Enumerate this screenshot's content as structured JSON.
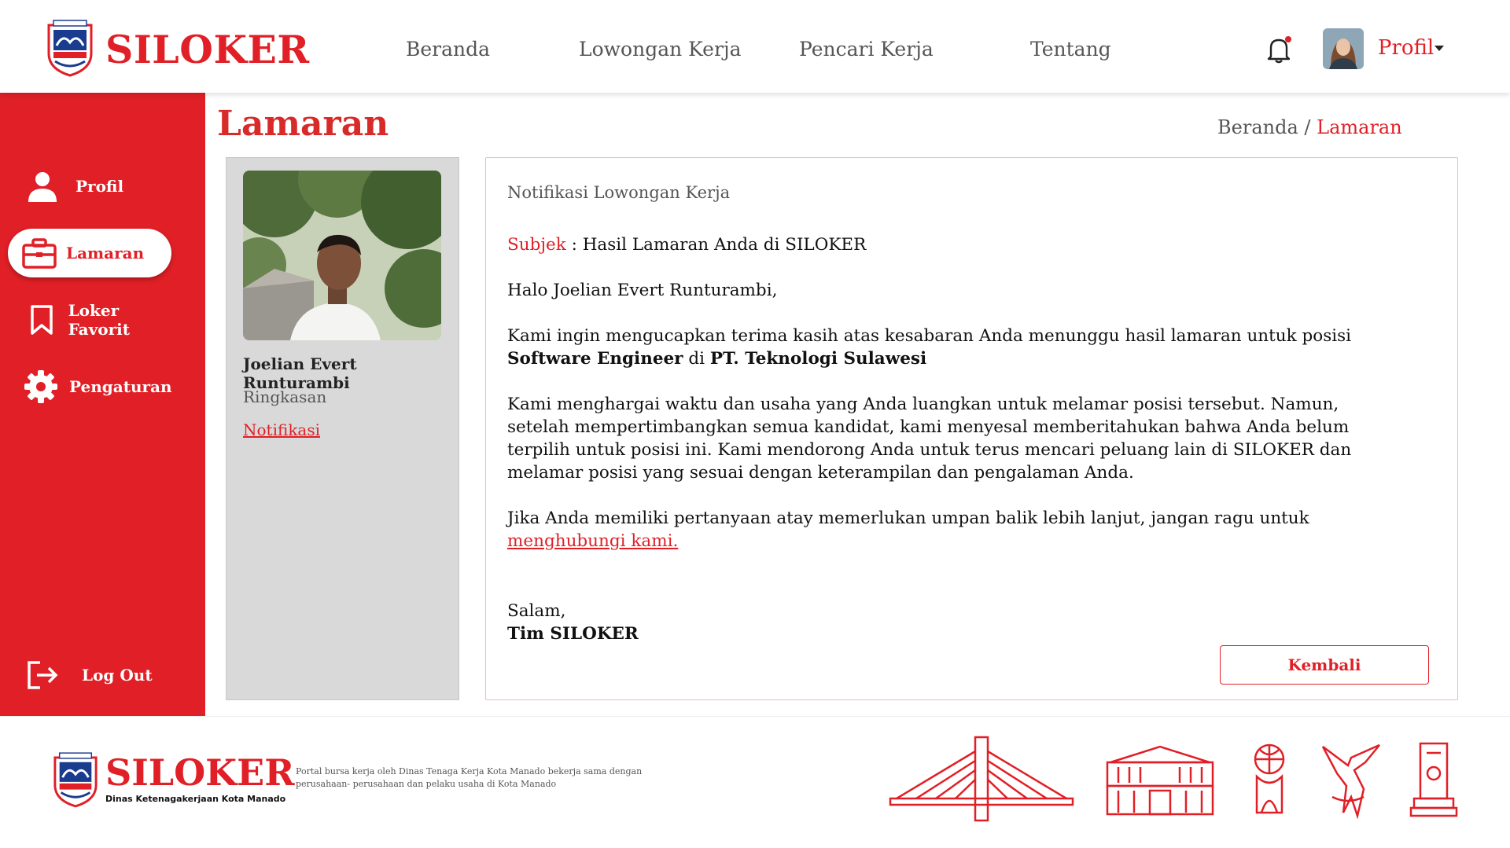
{
  "header": {
    "brand": "SILOKER",
    "nav": [
      "Beranda",
      "Lowongan Kerja",
      "Pencari Kerja",
      "Tentang"
    ],
    "profile_label": "Profil"
  },
  "sidebar": {
    "items": [
      {
        "label": "Profil",
        "icon": "user-icon",
        "active": false
      },
      {
        "label": "Lamaran",
        "icon": "briefcase-icon",
        "active": true
      },
      {
        "label": "Loker Favorit",
        "icon": "bookmark-icon",
        "active": false
      },
      {
        "label": "Pengaturan",
        "icon": "gear-icon",
        "active": false
      }
    ],
    "logout_label": "Log Out"
  },
  "page": {
    "title": "Lamaran",
    "breadcrumb_home": "Beranda",
    "breadcrumb_sep": "/",
    "breadcrumb_current": "Lamaran"
  },
  "profile_card": {
    "name": "Joelian Evert Runturambi",
    "link_summary": "Ringkasan",
    "link_notifications": "Notifikasi"
  },
  "message": {
    "heading": "Notifikasi Lowongan Kerja",
    "subject_label": "Subjek",
    "subject_sep": " : ",
    "subject": "Hasil Lamaran Anda di SILOKER",
    "greeting": "Halo Joelian Evert Runturambi,",
    "p1_text": "Kami ingin mengucapkan terima kasih atas kesabaran Anda menunggu hasil lamaran untuk posisi",
    "p1_position": "Software Engineer",
    "p1_at": " di ",
    "p1_company": "PT. Teknologi Sulawesi",
    "p2": "Kami menghargai waktu dan usaha yang Anda luangkan untuk melamar posisi  tersebut. Namun, setelah mempertimbangkan semua kandidat, kami menyesal memberitahukan bahwa Anda belum terpilih untuk posisi ini. Kami mendorong Anda untuk terus mencari peluang lain di SILOKER dan melamar posisi yang sesuai dengan keterampilan dan pengalaman Anda.",
    "p3_text": "Jika Anda memiliki pertanyaan atay memerlukan umpan balik lebih lanjut, jangan ragu untuk",
    "p3_link": "menghubungi kami.",
    "closing": "Salam,",
    "signature": "Tim SILOKER",
    "back_button": "Kembali"
  },
  "footer": {
    "brand": "SILOKER",
    "subtitle": "Dinas Ketenagakerjaan Kota Manado",
    "description": "Portal bursa kerja oleh Dinas Tenaga Kerja Kota Manado bekerja sama dengan perusahaan- perusahaan dan pelaku usaha di Kota Manado"
  },
  "colors": {
    "accent": "#e01f26",
    "card_gray": "#d9d9d9"
  }
}
